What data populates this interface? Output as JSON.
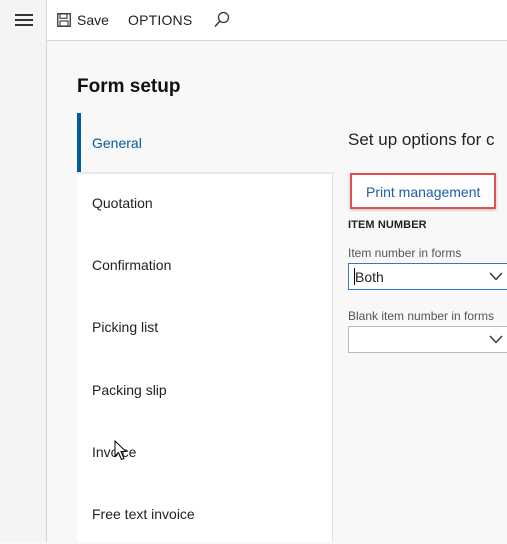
{
  "toolbar": {
    "save_label": "Save",
    "options_label": "OPTIONS"
  },
  "page": {
    "title": "Form setup"
  },
  "tabs": [
    {
      "label": "General",
      "selected": true
    },
    {
      "label": "Quotation",
      "selected": false
    },
    {
      "label": "Confirmation",
      "selected": false
    },
    {
      "label": "Picking list",
      "selected": false
    },
    {
      "label": "Packing slip",
      "selected": false
    },
    {
      "label": "Invoice",
      "selected": false
    },
    {
      "label": "Free text invoice",
      "selected": false
    }
  ],
  "general": {
    "heading": "Set up options for c",
    "print_management_label": "Print management",
    "item_number_group": "ITEM NUMBER",
    "item_number_in_forms_label": "Item number in forms",
    "item_number_in_forms_value": "Both",
    "blank_item_number_label": "Blank item number in forms",
    "blank_item_number_value": ""
  },
  "icons": {
    "menu": "hamburger-icon",
    "save": "save-icon",
    "search": "search-icon",
    "dropdown": "chevron-down-icon",
    "cursor": "mouse-pointer-icon"
  },
  "colors": {
    "accent": "#005a9e",
    "link": "#1a5fa8",
    "highlight_box": "#d9534f",
    "focus_border": "#2b79c8"
  }
}
